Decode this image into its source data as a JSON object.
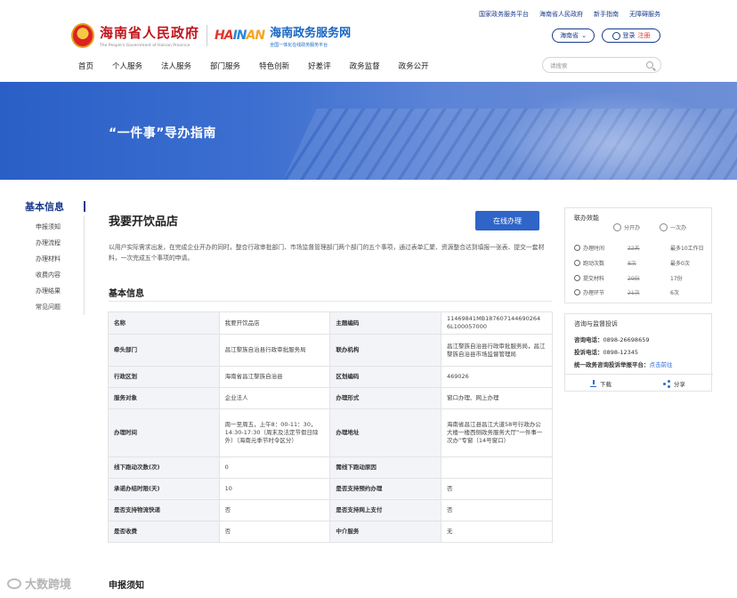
{
  "top_links": [
    "国家政务服务平台",
    "海南省人民政府",
    "新手指南",
    "无障碍服务"
  ],
  "header": {
    "gov_title": "海南省人民政府",
    "gov_sub": "The People's Government of Hainan Province",
    "hainan_logo": [
      "HA",
      "IN",
      "AN",
      ""
    ],
    "service_title": "海南政务服务网",
    "service_sub": "全国一体化在线政务服务平台",
    "region": "海南省",
    "login": "登录",
    "register": "注册"
  },
  "nav": [
    "首页",
    "个人服务",
    "法人服务",
    "部门服务",
    "特色创新",
    "好差评",
    "政务监督",
    "政务公开"
  ],
  "search": {
    "placeholder": "请搜索"
  },
  "banner": {
    "title": "“一件事”导办指南"
  },
  "sidebar": {
    "title": "基本信息",
    "items": [
      "申报须知",
      "办理流程",
      "办理材料",
      "收费内容",
      "办理结果",
      "常见问题"
    ]
  },
  "main": {
    "title": "我要开饮品店",
    "online_button": "在线办理",
    "intro": "以用户实际需求出发，在完成企业开办的同时，整合行政审批部门、市场监督管理部门两个部门的五个事项，通过表单汇聚、资源整合达到填报一张表、提交一套材料，一次完成五个事项的申请。",
    "section_title": "基本信息",
    "section2_title": "申报须知"
  },
  "info_table": [
    [
      "名称",
      "我要开饮品店",
      "主题编码",
      "11469841MB187607144690264 6L100057000"
    ],
    [
      "牵头部门",
      "昌江黎族自治县行政审批服务局",
      "联办机构",
      "昌江黎族自治县行政审批服务局，昌江黎族自治县市场监督管理局"
    ],
    [
      "行政区划",
      "海南省昌江黎族自治县",
      "区划编码",
      "469026"
    ],
    [
      "服务对象",
      "企业法人",
      "办理形式",
      "窗口办理、网上办理"
    ],
    [
      "办理时间",
      "周一至周五，上午8：00-11：30，14:30-17:30（周末及法定节假日除外）（海南元季节时令区分）",
      "办理地址",
      "海南省昌江县昌江大道58号行政办公大楼一楼西侧政务服务大厅“一件事一次办”专窗（14号窗口）"
    ],
    [
      "线下跑动次数(次)",
      "0",
      "需线下跑动原因",
      ""
    ],
    [
      "承诺办结时限(天)",
      "10",
      "是否支持预约办理",
      "否"
    ],
    [
      "是否支持物流快递",
      "否",
      "是否支持网上支付",
      "否"
    ],
    [
      "是否收费",
      "否",
      "中介服务",
      "无"
    ]
  ],
  "effect_panel": {
    "title": "联办效能",
    "tab1": "分开办",
    "tab2": "一次办",
    "rows": [
      {
        "label": "办理时间",
        "before": "22天",
        "after": "最多10工作日"
      },
      {
        "label": "跑动次数",
        "before": "8次",
        "after": "最多0次"
      },
      {
        "label": "提交材料",
        "before": "29份",
        "after": "17份"
      },
      {
        "label": "办理环节",
        "before": "21次",
        "after": "6次"
      }
    ]
  },
  "consult_panel": {
    "title": "咨询与监督投诉",
    "consult_label": "咨询电话：",
    "consult_value": "0898-26698659",
    "complain_label": "投诉电话：",
    "complain_value": "0898-12345",
    "platform_label": "统一政务咨询投诉举报平台：",
    "platform_link": "点击前往",
    "download": "下载",
    "share": "分享"
  },
  "watermark": "大数跨境"
}
